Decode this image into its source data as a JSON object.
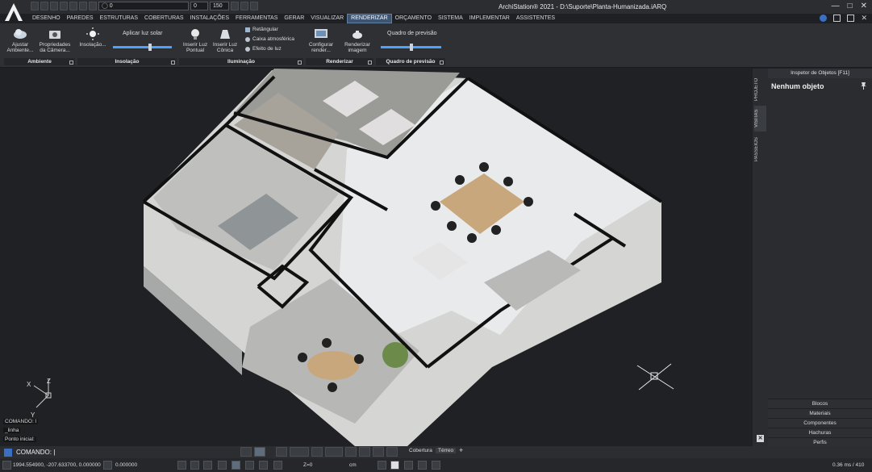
{
  "app": {
    "title": "ArchiStation® 2021  -  D:\\Suporte\\Planta-Humanizada.iARQ"
  },
  "quick_access": {
    "layer_value": "0",
    "field_a": "0",
    "field_b": "150"
  },
  "menu": [
    "DESENHO",
    "PAREDES",
    "ESTRUTURAS",
    "COBERTURAS",
    "INSTALAÇÕES",
    "FERRAMENTAS",
    "GERAR",
    "VISUALIZAR",
    "RENDERIZAR",
    "ORÇAMENTO",
    "SISTEMA",
    "IMPLEMENTAR",
    "ASSISTENTES"
  ],
  "active_menu": "RENDERIZAR",
  "ribbon": {
    "ajustar": "Ajustar Ambiente...",
    "propriedades": "Propriedades da Câmera...",
    "insolacao_btn": "Insolação...",
    "aplicar_luz": "Aplicar luz solar",
    "inserir_pontual": "Inserir Luz Pontual",
    "inserir_conica": "Inserir Luz Cônica",
    "retangular": "Retângular",
    "caixa": "Caixa atmosférica",
    "efeito": "Efeito de luz",
    "configurar": "Configurar render...",
    "renderizar_img": "Renderizar imagem",
    "quadro": "Quadro de previsão",
    "panels": [
      "Ambiente",
      "Insolação",
      "Iluminação",
      "Renderizar",
      "Quadro de previsão"
    ]
  },
  "side_tabs": [
    "PROJETO",
    "VISITAS",
    "PASSEIOS"
  ],
  "inspector": {
    "header": "Inspetor de Objetos [F11]",
    "title": "Nenhum objeto",
    "list": [
      "Blocos",
      "Materiais",
      "Componentes",
      "Hachuras",
      "Perfis"
    ]
  },
  "command_history": [
    "COMANDO: l",
    "_linha",
    "Ponto inicial:"
  ],
  "command_prompt": "COMANDO:",
  "view_tabs": [
    "Cobertura",
    "Térreo"
  ],
  "status": {
    "coords": "1994.554900, -207.633700, 0.000000",
    "angle": "0.000000",
    "z": "Z=0",
    "unit": "cm",
    "perf": "0.36 ms / 410"
  },
  "colors": {
    "accent": "#4ea1ff",
    "active_menu": "#3d5573",
    "background": "#1f2124"
  }
}
